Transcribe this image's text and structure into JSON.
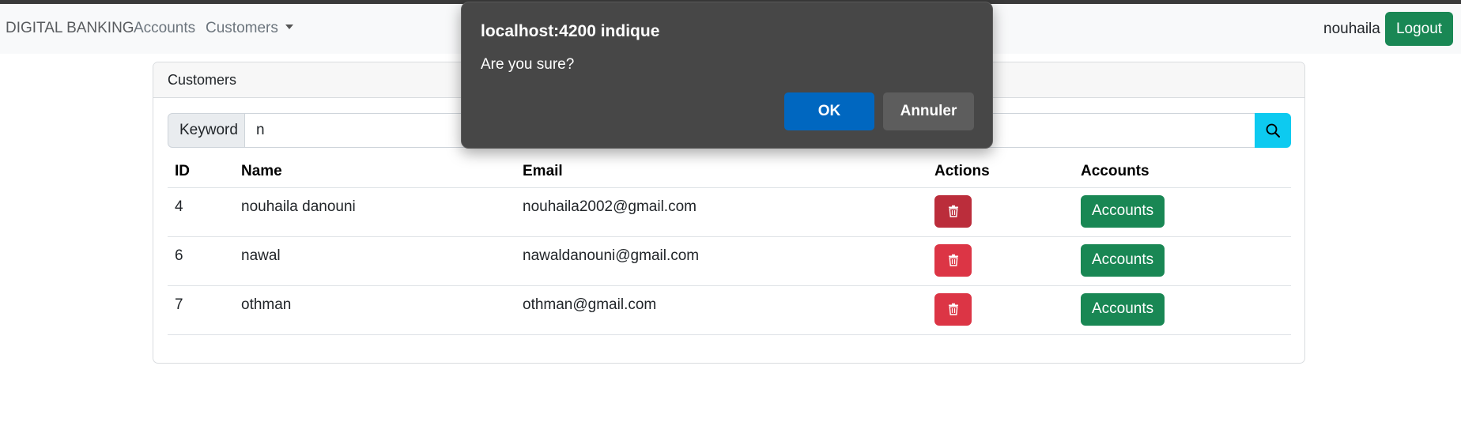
{
  "navbar": {
    "brand": "DIGITAL BANKING",
    "links": [
      "Accounts",
      "Customers"
    ],
    "username": "nouhaila",
    "logout_label": "Logout"
  },
  "card": {
    "header": "Customers",
    "search": {
      "label": "Keyword",
      "value": "n",
      "button_icon": "search-icon"
    },
    "table": {
      "headers": [
        "ID",
        "Name",
        "Email",
        "Actions",
        "Accounts"
      ],
      "rows": [
        {
          "id": "4",
          "name": "nouhaila danouni",
          "email": "nouhaila2002@gmail.com",
          "delete_icon": "trash-icon",
          "accounts_label": "Accounts"
        },
        {
          "id": "6",
          "name": "nawal",
          "email": "nawaldanouni@gmail.com",
          "delete_icon": "trash-icon",
          "accounts_label": "Accounts"
        },
        {
          "id": "7",
          "name": "othman",
          "email": "othman@gmail.com",
          "delete_icon": "trash-icon",
          "accounts_label": "Accounts"
        }
      ]
    }
  },
  "dialog": {
    "title": "localhost:4200 indique",
    "message": "Are you sure?",
    "ok_label": "OK",
    "cancel_label": "Annuler"
  },
  "colors": {
    "success": "#198754",
    "danger": "#dc3545",
    "danger_active": "#bb2d3b",
    "info": "#0dcaf0",
    "dialog_bg": "#474747",
    "dialog_primary": "#0067c0"
  }
}
